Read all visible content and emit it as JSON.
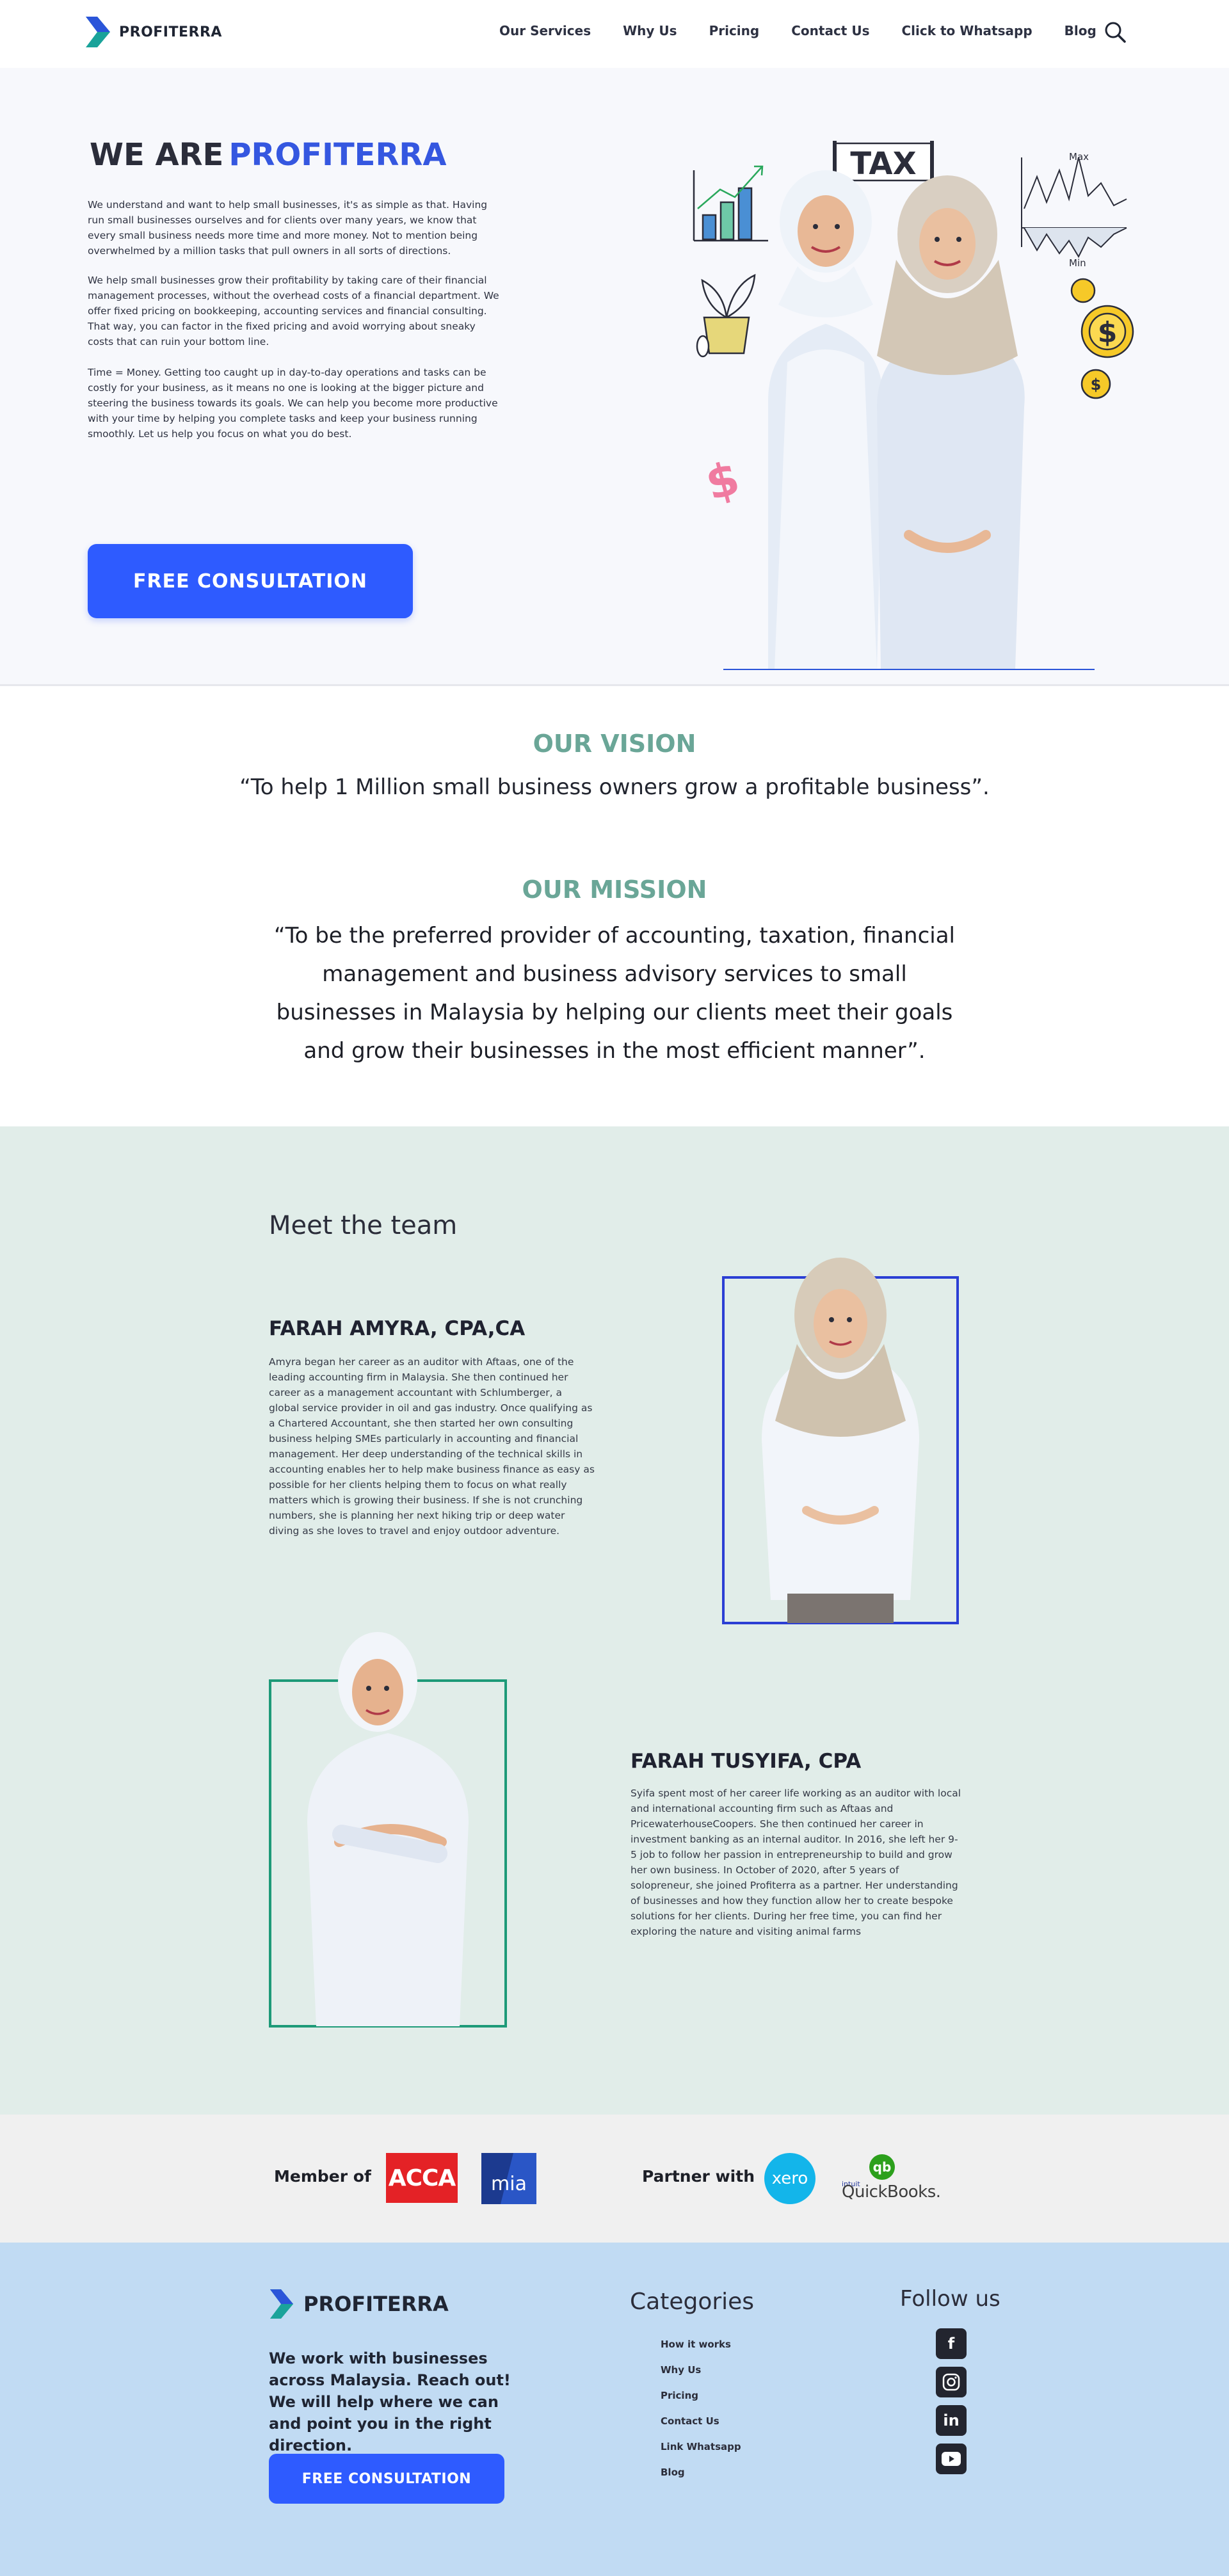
{
  "nav": {
    "brand": "PROFITERRA",
    "items": [
      "Our Services",
      "Why Us",
      "Pricing",
      "Contact Us",
      "Click to Whatsapp",
      "Blog"
    ]
  },
  "hero": {
    "title_a": "WE ARE",
    "title_b": "PROFITERRA",
    "p1": "We understand and want to help small businesses, it's as simple as that. Having run small businesses ourselves and for clients over many years, we know that every small business needs more time and more money. Not to mention being overwhelmed by a million tasks that pull owners in all sorts of directions.",
    "p2": "We help small businesses grow their profitability by taking care of their financial management processes, without the overhead costs of a financial department. We offer fixed pricing on bookkeeping, accounting services and financial consulting. That way, you can factor in the fixed pricing and avoid worrying about sneaky costs that can ruin your bottom line.",
    "p3": "Time = Money. Getting too caught up in day-to-day operations and tasks can be costly for your business, as it means no one is looking at the bigger picture and steering the business towards its goals. We can help you become more productive with your time by helping you complete tasks and keep your business running smoothly. Let us help you focus on what you do best.",
    "cta": "FREE CONSULTATION",
    "art_tax": "TAX",
    "art_max": "Max",
    "art_min": "Min"
  },
  "vision": {
    "heading": "OUR VISION",
    "text": "“To help 1 Million small business owners grow a profitable business”."
  },
  "mission": {
    "heading": "OUR MISSION",
    "text": "“To be the preferred provider of accounting, taxation, financial management and business advisory services to small businesses in Malaysia by helping our clients meet their goals and grow their businesses in the most efficient manner”."
  },
  "team": {
    "title": "Meet the team",
    "members": [
      {
        "name": "FARAH AMYRA, CPA,CA",
        "bio": "Amyra began her career as an auditor with Aftaas, one of the leading accounting firm in Malaysia. She then continued her career as a management accountant with Schlumberger, a global service provider in oil and gas industry. Once qualifying as a Chartered Accountant, she then started her own consulting business helping SMEs particularly in accounting and financial management. Her deep understanding of the technical skills in accounting enables her to help make business finance as easy as possible for her clients helping them to focus on what really matters which is growing their business. If she is not crunching numbers, she is planning her next hiking trip or deep water diving as she loves to travel and enjoy outdoor adventure."
      },
      {
        "name": "FARAH TUSYIFA, CPA",
        "bio": "Syifa spent most of her career life working as an auditor with local and international accounting firm such as Aftaas and PricewaterhouseCoopers. She then continued her career in investment banking as an internal auditor. In 2016, she left her 9-5 job to follow her passion in entrepreneurship to build and grow her own business. In October of 2020, after 5 years of solopreneur, she joined Profiterra as a partner. Her understanding of businesses and how they function allow her to create bespoke solutions for her clients. During her free time, you can find her exploring the nature and visiting animal farms"
      }
    ]
  },
  "assoc": {
    "member_label": "Member of",
    "acca": "ACCA",
    "mia": "mia",
    "partner_label": "Partner with",
    "xero": "xero",
    "qb_intuit": "intuit",
    "qb_name": "QuickBooks.",
    "qb_icon": "qb"
  },
  "footer": {
    "brand": "PROFITERRA",
    "text": "We work with businesses across Malaysia. Reach out! We will help where we can and point you in the right direction.",
    "cta": "FREE CONSULTATION",
    "categories_title": "Categories",
    "categories": [
      "How it works",
      "Why Us",
      "Pricing",
      "Contact Us",
      "Link Whatsapp",
      "Blog"
    ],
    "follow_title": "Follow us",
    "social_icons": [
      "facebook-icon",
      "instagram-icon",
      "linkedin-icon",
      "youtube-icon"
    ]
  },
  "colors": {
    "accent_blue": "#2e5bff",
    "brand_blue": "#3557e0",
    "vision_green": "#6aa697",
    "team_bg": "#e1ede9",
    "footer_bg": "#c1dbf3"
  }
}
